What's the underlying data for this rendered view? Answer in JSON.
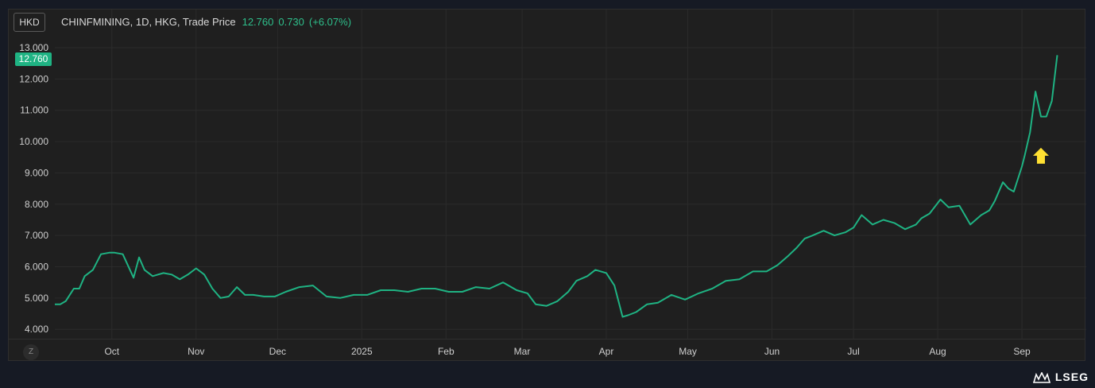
{
  "header": {
    "currency": "HKD",
    "symbol_info": "CHINFMINING, 1D, HKG, Trade Price",
    "last_price": "12.760",
    "change": "0.730",
    "change_pct": "(+6.07%)"
  },
  "price_tag": "12.760",
  "zoom_button": "Z",
  "brand": "LSEG",
  "colors": {
    "line": "#1fb383",
    "arrow": "#ffe032",
    "background": "#1f1f1f",
    "grid": "#2b2b2b"
  },
  "chart_data": {
    "type": "line",
    "title": "",
    "xlabel": "",
    "ylabel": "",
    "ylim": [
      3.7,
      13.0
    ],
    "ytick_values": [
      4,
      5,
      6,
      7,
      8,
      9,
      10,
      11,
      12,
      13
    ],
    "ytick_labels": [
      "4.000",
      "5.000",
      "6.000",
      "7.000",
      "8.000",
      "9.000",
      "10.000",
      "11.000",
      "12.000",
      "13.000"
    ],
    "xlim": [
      "2024-09-10",
      "2025-09-20"
    ],
    "xticks": [
      {
        "date": "2024-10-01",
        "label": "Oct"
      },
      {
        "date": "2024-11-01",
        "label": "Nov"
      },
      {
        "date": "2024-12-01",
        "label": "Dec"
      },
      {
        "date": "2025-01-01",
        "label": "2025"
      },
      {
        "date": "2025-02-01",
        "label": "Feb"
      },
      {
        "date": "2025-03-01",
        "label": "Mar"
      },
      {
        "date": "2025-04-01",
        "label": "Apr"
      },
      {
        "date": "2025-05-01",
        "label": "May"
      },
      {
        "date": "2025-06-01",
        "label": "Jun"
      },
      {
        "date": "2025-07-01",
        "label": "Jul"
      },
      {
        "date": "2025-08-01",
        "label": "Aug"
      },
      {
        "date": "2025-09-01",
        "label": "Sep"
      }
    ],
    "grid": true,
    "series": [
      {
        "name": "",
        "x": [
          "2024-09-10",
          "2024-09-12",
          "2024-09-14",
          "2024-09-17",
          "2024-09-19",
          "2024-09-21",
          "2024-09-24",
          "2024-09-27",
          "2024-09-30",
          "2024-10-02",
          "2024-10-05",
          "2024-10-09",
          "2024-10-11",
          "2024-10-13",
          "2024-10-16",
          "2024-10-18",
          "2024-10-20",
          "2024-10-23",
          "2024-10-26",
          "2024-10-29",
          "2024-11-01",
          "2024-11-04",
          "2024-11-07",
          "2024-11-10",
          "2024-11-13",
          "2024-11-16",
          "2024-11-19",
          "2024-11-22",
          "2024-11-26",
          "2024-11-30",
          "2024-12-04",
          "2024-12-09",
          "2024-12-14",
          "2024-12-19",
          "2024-12-24",
          "2024-12-29",
          "2025-01-03",
          "2025-01-08",
          "2025-01-13",
          "2025-01-18",
          "2025-01-23",
          "2025-01-28",
          "2025-02-02",
          "2025-02-07",
          "2025-02-12",
          "2025-02-17",
          "2025-02-22",
          "2025-02-27",
          "2025-03-03",
          "2025-03-06",
          "2025-03-10",
          "2025-03-14",
          "2025-03-18",
          "2025-03-21",
          "2025-03-25",
          "2025-03-28",
          "2025-04-01",
          "2025-04-04",
          "2025-04-07",
          "2025-04-09",
          "2025-04-12",
          "2025-04-16",
          "2025-04-20",
          "2025-04-25",
          "2025-04-30",
          "2025-05-05",
          "2025-05-10",
          "2025-05-15",
          "2025-05-20",
          "2025-05-25",
          "2025-05-30",
          "2025-06-03",
          "2025-06-07",
          "2025-06-10",
          "2025-06-13",
          "2025-06-16",
          "2025-06-20",
          "2025-06-24",
          "2025-06-28",
          "2025-07-01",
          "2025-07-04",
          "2025-07-08",
          "2025-07-12",
          "2025-07-16",
          "2025-07-20",
          "2025-07-24",
          "2025-07-26",
          "2025-07-29",
          "2025-08-02",
          "2025-08-05",
          "2025-08-09",
          "2025-08-13",
          "2025-08-17",
          "2025-08-20",
          "2025-08-22",
          "2025-08-25",
          "2025-08-27",
          "2025-08-29",
          "2025-09-01",
          "2025-09-02",
          "2025-09-04",
          "2025-09-06",
          "2025-09-08",
          "2025-09-10",
          "2025-09-12",
          "2025-09-14"
        ],
        "values": [
          4.8,
          4.8,
          4.9,
          5.3,
          5.3,
          5.7,
          5.9,
          6.4,
          6.45,
          6.45,
          6.4,
          5.65,
          6.3,
          5.9,
          5.7,
          5.75,
          5.8,
          5.75,
          5.6,
          5.75,
          5.95,
          5.75,
          5.3,
          5.0,
          5.05,
          5.35,
          5.1,
          5.1,
          5.05,
          5.05,
          5.2,
          5.35,
          5.4,
          5.05,
          5.0,
          5.1,
          5.1,
          5.25,
          5.25,
          5.2,
          5.3,
          5.3,
          5.2,
          5.2,
          5.35,
          5.3,
          5.5,
          5.25,
          5.15,
          4.8,
          4.75,
          4.9,
          5.2,
          5.55,
          5.7,
          5.9,
          5.8,
          5.4,
          4.4,
          4.45,
          4.55,
          4.8,
          4.85,
          5.1,
          4.95,
          5.15,
          5.3,
          5.55,
          5.6,
          5.85,
          5.85,
          6.05,
          6.35,
          6.6,
          6.9,
          7.0,
          7.15,
          7.0,
          7.1,
          7.25,
          7.65,
          7.35,
          7.5,
          7.4,
          7.2,
          7.35,
          7.55,
          7.7,
          8.15,
          7.9,
          7.95,
          7.35,
          7.65,
          7.8,
          8.1,
          8.7,
          8.5,
          8.4,
          9.2,
          9.55,
          10.3,
          11.6,
          10.8,
          10.8,
          11.3,
          12.76
        ]
      }
    ],
    "annotations": [
      {
        "type": "arrow-up",
        "x": "2025-09-08",
        "y": 9.8
      }
    ]
  }
}
